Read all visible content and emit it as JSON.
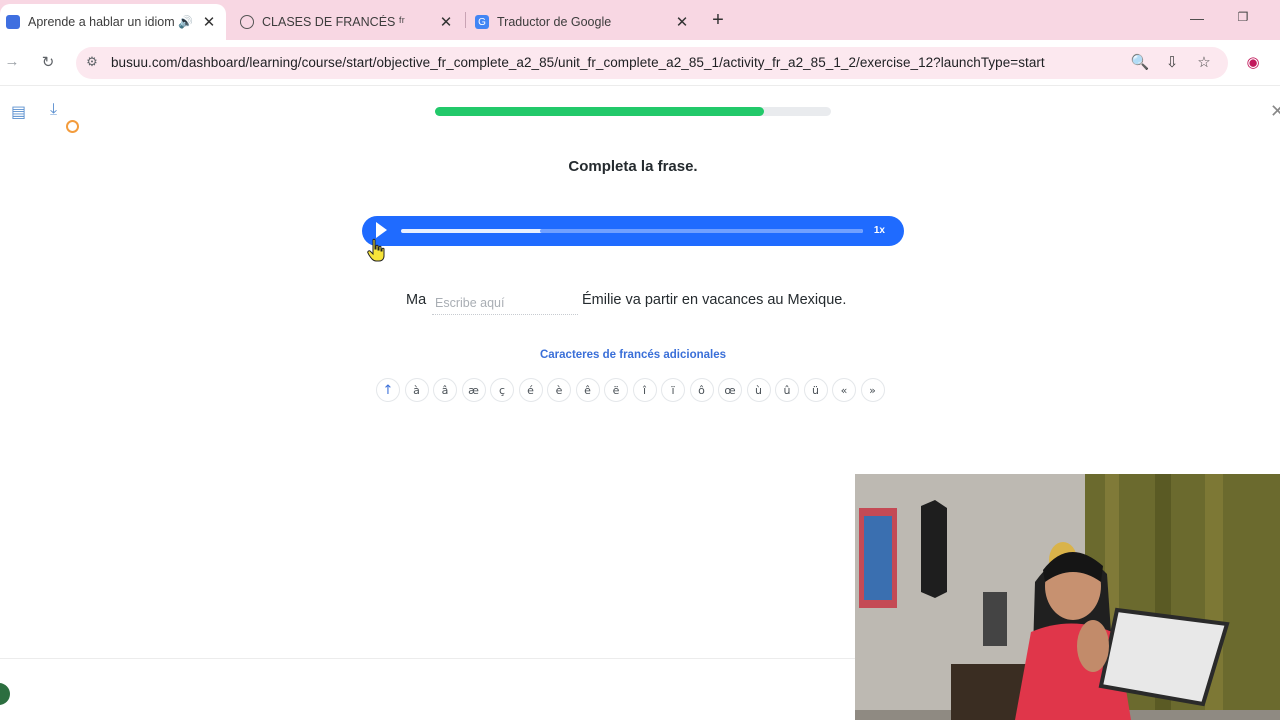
{
  "browser": {
    "tabs": [
      {
        "title": "Aprende a hablar un idioma",
        "active": true
      },
      {
        "title": "CLASES DE FRANCÉS ᶠʳ",
        "active": false
      },
      {
        "title": "Traductor de Google",
        "active": false
      }
    ],
    "url": "busuu.com/dashboard/learning/course/start/objective_fr_complete_a2_85/unit_fr_complete_a2_85_1/activity_fr_a2_85_1_2/exercise_12?launchType=start",
    "icons": {
      "back": "arrow-left-icon",
      "reload": "reload-icon",
      "site_info": "tune-icon",
      "zoom": "magnifier-icon",
      "install": "install-app-icon",
      "bookmark": "star-icon",
      "profile": "profile-icon"
    }
  },
  "lesson": {
    "progress_fraction": 0.83,
    "instruction": "Completa la frase.",
    "audio": {
      "speed_label": "1x",
      "played_fraction": 0.3
    },
    "sentence": {
      "before": "Ma",
      "input_placeholder": "Escribe aquí",
      "input_value": "",
      "after": "Émilie va partir en vacances au Mexique."
    },
    "extra_chars_title": "Caracteres de francés adicionales",
    "extra_chars": [
      "à",
      "â",
      "æ",
      "ç",
      "é",
      "è",
      "ê",
      "ë",
      "î",
      "ï",
      "ô",
      "œ",
      "ù",
      "û",
      "ü",
      "«",
      "»"
    ]
  },
  "colors": {
    "tabstrip": "#f8d7e3",
    "omnibox": "#fce8ef",
    "progress": "#22c96a",
    "player": "#1f6bff",
    "link": "#3a6fd8"
  }
}
